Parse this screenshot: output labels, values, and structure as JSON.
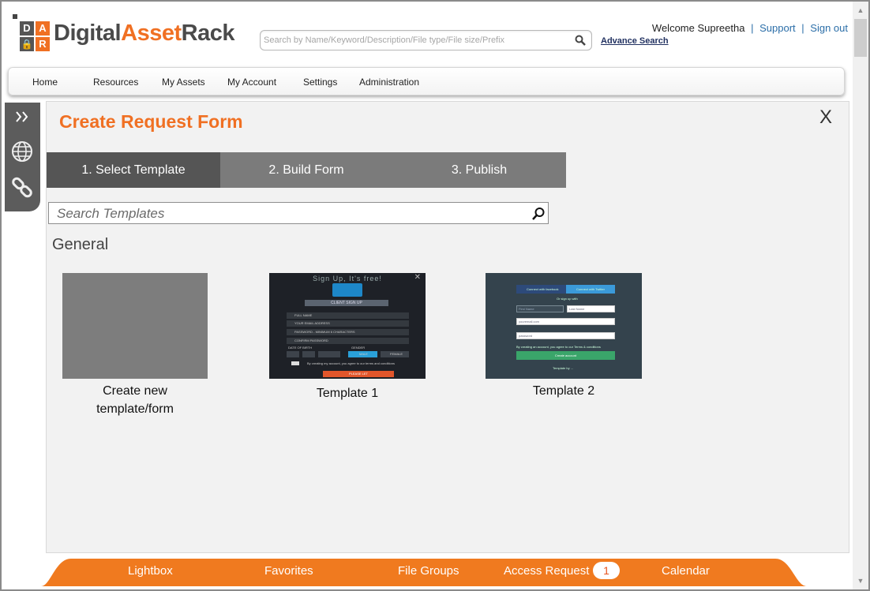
{
  "brand": {
    "logo_tiles": [
      "D",
      "A",
      "R"
    ],
    "name_part1": "Digital",
    "name_part2": "Asset",
    "name_part3": "Rack",
    "accent_color": "#f07023"
  },
  "header": {
    "search_placeholder": "Search by Name/Keyword/Description/File type/File size/Prefix",
    "advance_search_label": "Advance Search",
    "welcome_text": "Welcome Supreetha",
    "support_label": "Support",
    "signout_label": "Sign out",
    "separator": "|"
  },
  "nav": {
    "items": [
      "Home",
      "Resources",
      "My Assets",
      "My Account",
      "Settings",
      "Administration"
    ]
  },
  "sidebar": {
    "icons": [
      "expand-icon",
      "globe-icon",
      "link-icon"
    ]
  },
  "form": {
    "title": "Create Request Form",
    "close_label": "X",
    "steps": [
      {
        "label": "1. Select Template",
        "active": true
      },
      {
        "label": "2. Build Form",
        "active": false
      },
      {
        "label": "3. Publish",
        "active": false
      }
    ],
    "search_placeholder": "Search Templates",
    "section_label": "General",
    "cards": [
      {
        "caption_line1": "Create new",
        "caption_line2": "template/form"
      },
      {
        "caption": "Template 1"
      },
      {
        "caption": "Template 2"
      }
    ]
  },
  "template1_preview": {
    "title": "Sign Up, It's free!",
    "close": "✕",
    "dropdown": "CLIENT SIGN UP",
    "fields": [
      "FULL NAME",
      "YOUR EMAIL ADDRESS",
      "PASSWORD - MINIMUM 6 CHARACTERS",
      "CONFIRM PASSWORD"
    ],
    "dob_label": "DATE OF BIRTH",
    "gender_label": "GENDER",
    "male": "MALE",
    "female": "FEMALE",
    "terms": "By creating my account, you agree to our terms and conditions",
    "button": "PLEASE LET"
  },
  "template2_preview": {
    "facebook": "Connect with facebook",
    "twitter": "Connect with Twitter",
    "or": "Or sign up with",
    "first_name": "First Name",
    "last_name": "Last Name",
    "email": "youremail.com",
    "password": "password",
    "agree": "By creating an account, you agree to our Terms & conditions",
    "button": "Create account",
    "footer": "Template by ..."
  },
  "bottom_bar": {
    "items": [
      "Lightbox",
      "Favorites",
      "File Groups",
      "Access Request",
      "Calendar"
    ],
    "access_request_count": "1",
    "color": "#f07a1f"
  }
}
